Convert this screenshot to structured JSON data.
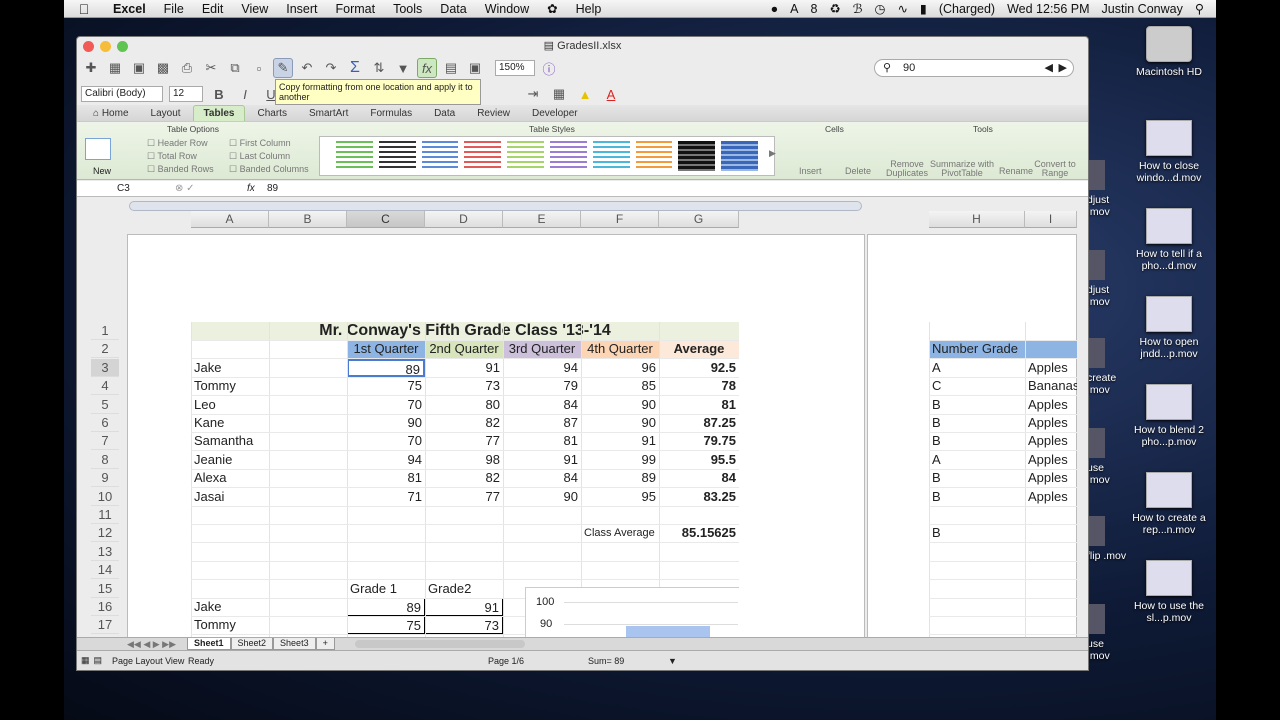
{
  "menubar": {
    "app": "Excel",
    "items": [
      "File",
      "Edit",
      "View",
      "Insert",
      "Format",
      "Tools",
      "Data",
      "Window",
      "Help"
    ],
    "status": {
      "badge": "8",
      "battery": "(Charged)",
      "clock": "Wed 12:56 PM",
      "user": "Justin Conway"
    }
  },
  "window": {
    "title": "GradesII.xlsx"
  },
  "toolbar": {
    "zoom": "150%",
    "search_value": "90"
  },
  "format_toolbar": {
    "font": "Calibri (Body)",
    "size": "12"
  },
  "tooltip": {
    "text": "Copy formatting from one location and apply it to another"
  },
  "ribbon": {
    "tabs": [
      "Home",
      "Layout",
      "Tables",
      "Charts",
      "SmartArt",
      "Formulas",
      "Data",
      "Review",
      "Developer"
    ],
    "active_tab": "Tables",
    "groups": {
      "table_options": "Table Options",
      "table_styles": "Table Styles",
      "cells": "Cells",
      "tools": "Tools"
    },
    "options": {
      "new": "New",
      "header_row": "Header Row",
      "total_row": "Total Row",
      "banded_rows": "Banded Rows",
      "first_column": "First Column",
      "last_column": "Last Column",
      "banded_columns": "Banded Columns"
    },
    "cells_buttons": {
      "insert": "Insert",
      "delete": "Delete"
    },
    "tools_buttons": {
      "remove_duplicates": "Remove Duplicates",
      "summarize": "Summarize with PivotTable",
      "rename": "Rename",
      "convert": "Convert to Range"
    }
  },
  "formula_bar": {
    "cell_ref": "C3",
    "fx": "fx",
    "value": "89"
  },
  "columns": [
    "A",
    "B",
    "C",
    "D",
    "E",
    "F",
    "G",
    "H",
    "I"
  ],
  "rows": [
    "1",
    "2",
    "3",
    "4",
    "5",
    "6",
    "7",
    "8",
    "9",
    "10",
    "11",
    "12",
    "13",
    "14",
    "15",
    "16",
    "17"
  ],
  "sheet": {
    "title": "Mr. Conway's Fifth Grade Class '13-'14",
    "headers": [
      "1st Quarter",
      "2nd Quarter",
      "3rd Quarter",
      "4th Quarter",
      "Average"
    ],
    "students": [
      {
        "name": "Jake",
        "q": [
          "89",
          "91",
          "94",
          "96"
        ],
        "avg": "92.5"
      },
      {
        "name": "Tommy",
        "q": [
          "75",
          "73",
          "79",
          "85"
        ],
        "avg": "78"
      },
      {
        "name": "Leo",
        "q": [
          "70",
          "80",
          "84",
          "90"
        ],
        "avg": "81"
      },
      {
        "name": "Kane",
        "q": [
          "90",
          "82",
          "87",
          "90"
        ],
        "avg": "87.25"
      },
      {
        "name": "Samantha",
        "q": [
          "70",
          "77",
          "81",
          "91"
        ],
        "avg": "79.75"
      },
      {
        "name": "Jeanie",
        "q": [
          "94",
          "98",
          "91",
          "99"
        ],
        "avg": "95.5"
      },
      {
        "name": "Alexa",
        "q": [
          "81",
          "82",
          "84",
          "89"
        ],
        "avg": "84"
      },
      {
        "name": "Jasai",
        "q": [
          "71",
          "77",
          "90",
          "95"
        ],
        "avg": "83.25"
      }
    ],
    "class_average_label": "Class Average",
    "class_average": "85.15625",
    "grade_headers": [
      "Grade 1",
      "Grade2"
    ],
    "grades": [
      {
        "name": "Jake",
        "g1": "89",
        "g2": "91"
      },
      {
        "name": "Tommy",
        "g1": "75",
        "g2": "73"
      }
    ],
    "chart_ticks": [
      "100",
      "90"
    ],
    "right": {
      "header": "Number Grade",
      "letters": [
        "A",
        "C",
        "B",
        "B",
        "B",
        "A",
        "B",
        "B"
      ],
      "fruits": [
        "Apples",
        "Bananas",
        "Apples",
        "Apples",
        "Apples",
        "Apples",
        "Apples",
        "Apples"
      ],
      "row12": "B"
    }
  },
  "sheet_tabs": [
    "Sheet1",
    "Sheet2",
    "Sheet3",
    "+"
  ],
  "statusbar": {
    "view": "Page Layout View",
    "ready": "Ready",
    "page": "Page 1/6",
    "sum": "Sum= 89"
  },
  "desktop": [
    {
      "label": "Macintosh HD"
    },
    {
      "label": "How to close windo...d.mov"
    },
    {
      "label": "How to tell if a pho...d.mov"
    },
    {
      "label": "How to open jndd...p.mov"
    },
    {
      "label": "How to blend 2 pho...p.mov"
    },
    {
      "label": "How to create a rep...n.mov"
    },
    {
      "label": "How to use the sl...p.mov"
    }
  ],
  "desktop_peek": [
    "djust .mov",
    "djust .mov",
    "create .mov",
    "use .mov",
    "flip .mov",
    "use .mov"
  ],
  "colors": {
    "green_ribbon": "#d7ecc8",
    "q1": "#8db4e2",
    "q2": "#d8e4bc",
    "q3": "#ccc0da",
    "q4": "#fcd5b4",
    "avg": "#fde9d9",
    "title_bg": "#ebf1de"
  }
}
